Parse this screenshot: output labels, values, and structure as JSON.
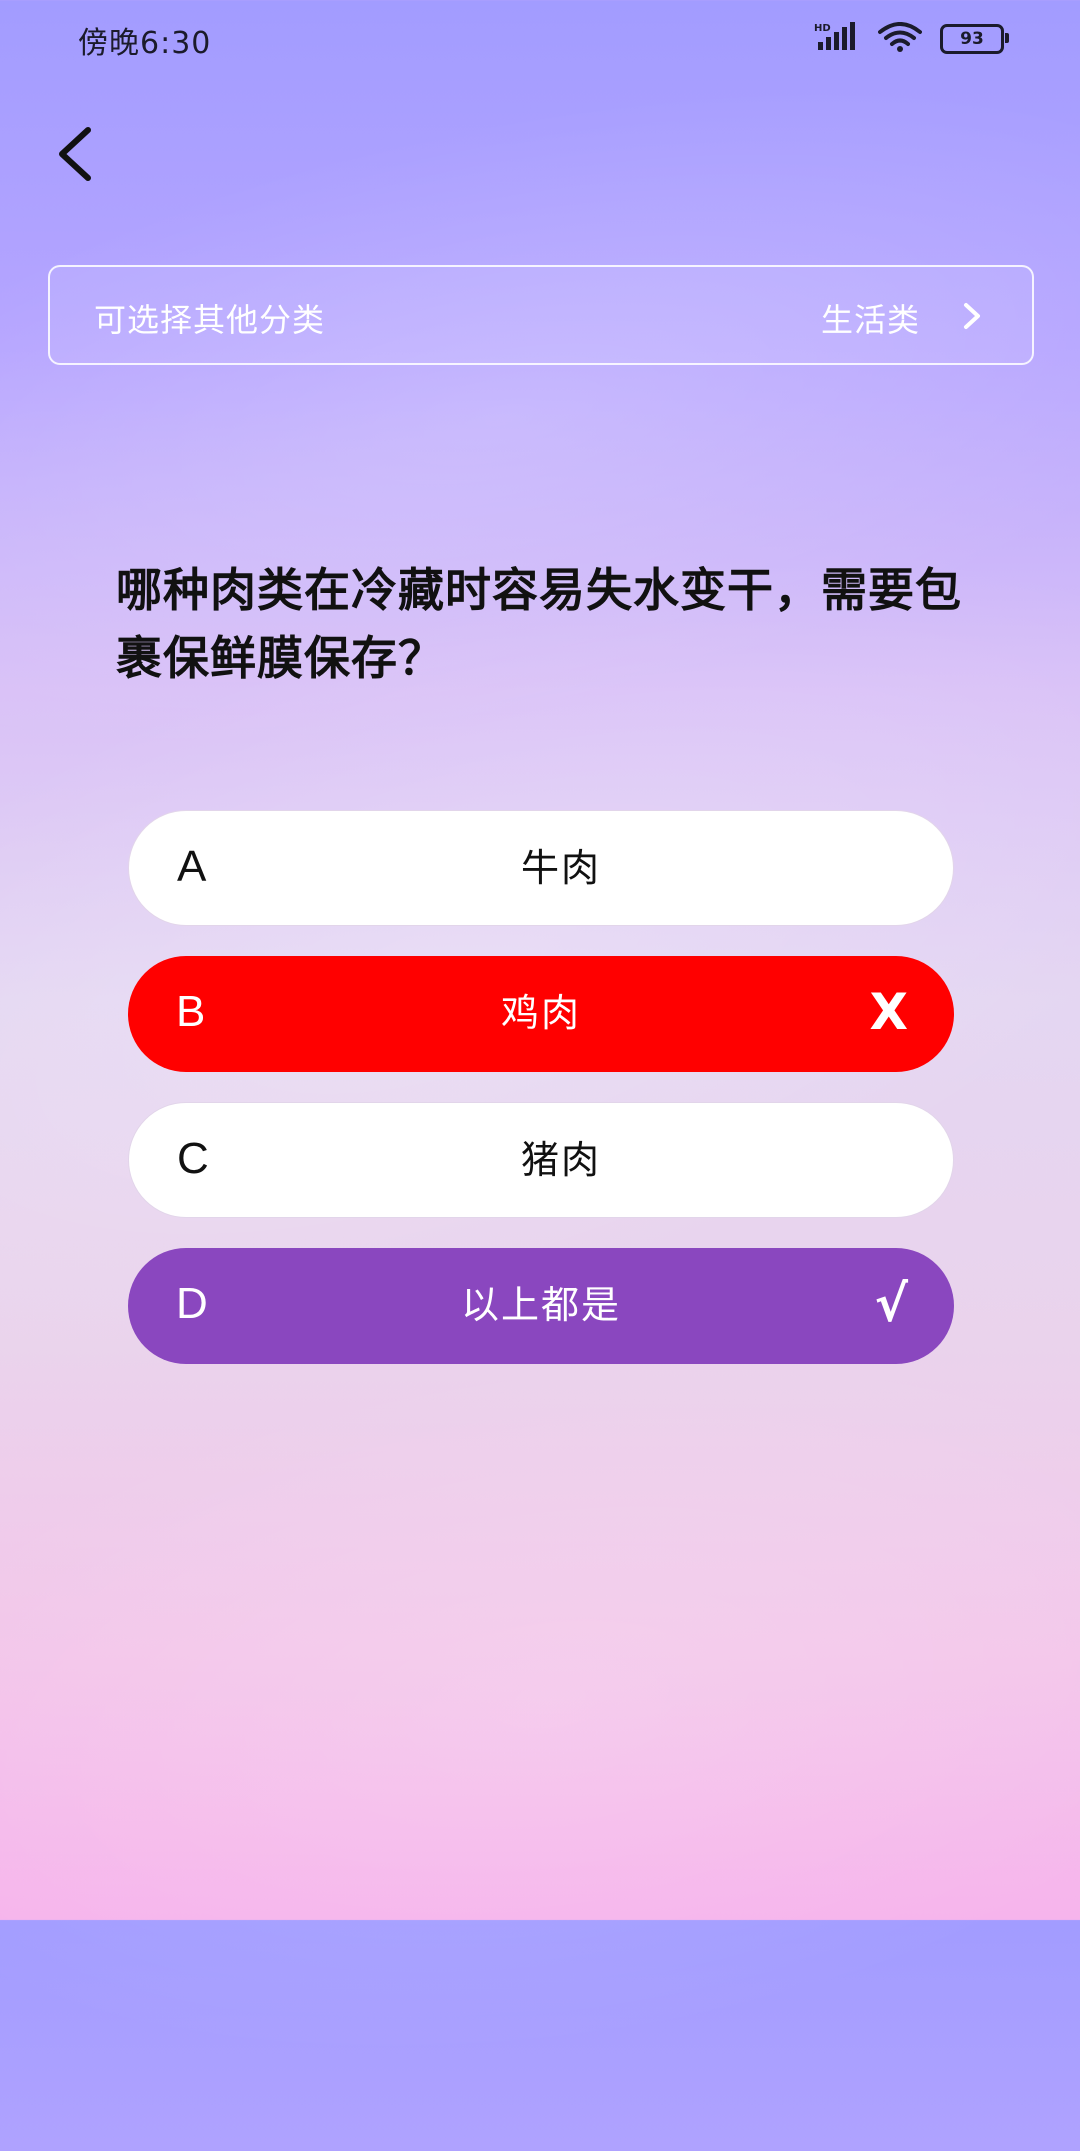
{
  "status_bar": {
    "time": "傍晚6:30",
    "battery": "93",
    "signal_icon": "signal-icon",
    "wifi_icon": "wifi-icon"
  },
  "nav": {
    "back_icon": "back-arrow-icon"
  },
  "category": {
    "hint": "可选择其他分类",
    "current": "生活类",
    "chevron_icon": "chevron-right-icon"
  },
  "question": {
    "text": "哪种肉类在冷藏时容易失水变干，需要包裹保鲜膜保存？"
  },
  "options": [
    {
      "letter": "A",
      "text": "牛肉",
      "state": "neutral",
      "mark": ""
    },
    {
      "letter": "B",
      "text": "鸡肉",
      "state": "wrong",
      "mark": "X"
    },
    {
      "letter": "C",
      "text": "猪肉",
      "state": "neutral",
      "mark": ""
    },
    {
      "letter": "D",
      "text": "以上都是",
      "state": "correct",
      "mark": "√"
    }
  ],
  "colors": {
    "wrong": "#ff0000",
    "correct": "#8a47bf",
    "neutral": "#ffffff"
  }
}
